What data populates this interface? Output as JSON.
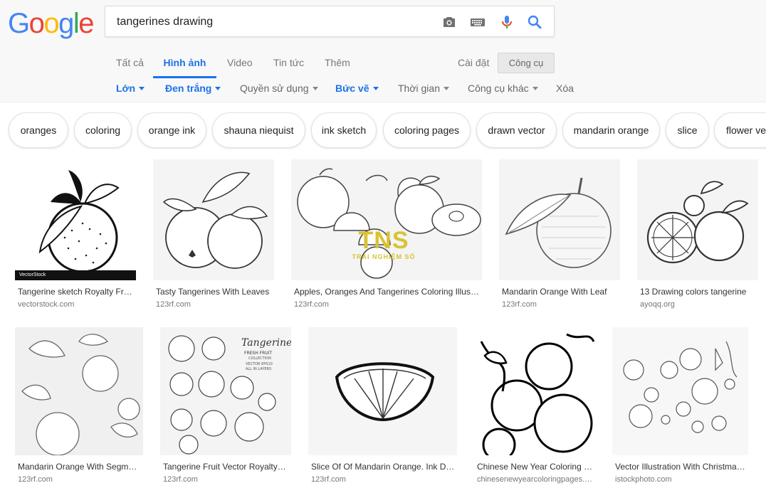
{
  "logo": {
    "letters": [
      "G",
      "o",
      "o",
      "g",
      "l",
      "e"
    ],
    "colors": [
      "#4285f4",
      "#ea4335",
      "#fbbc05",
      "#4285f4",
      "#34a853",
      "#ea4335"
    ]
  },
  "search": {
    "query": "tangerines drawing"
  },
  "icons": {
    "camera": "camera-icon",
    "keyboard": "keyboard-icon",
    "mic": "mic-icon",
    "search": "search-icon"
  },
  "tabs": [
    {
      "label": "Tất cả"
    },
    {
      "label": "Hình ảnh",
      "active": true
    },
    {
      "label": "Video"
    },
    {
      "label": "Tin tức"
    },
    {
      "label": "Thêm"
    }
  ],
  "settings_label": "Cài đặt",
  "tools_label": "Công cụ",
  "filters": [
    {
      "label": "Lớn",
      "selected": true,
      "dropdown": true
    },
    {
      "label": "Đen trắng",
      "selected": true,
      "dropdown": true
    },
    {
      "label": "Quyền sử dụng",
      "selected": false,
      "dropdown": true
    },
    {
      "label": "Bức vẽ",
      "selected": true,
      "dropdown": true
    },
    {
      "label": "Thời gian",
      "selected": false,
      "dropdown": true
    },
    {
      "label": "Công cụ khác",
      "selected": false,
      "dropdown": true
    },
    {
      "label": "Xóa",
      "selected": false,
      "dropdown": false
    }
  ],
  "chips": [
    "oranges",
    "coloring",
    "orange ink",
    "shauna niequist",
    "ink sketch",
    "coloring pages",
    "drawn vector",
    "mandarin orange",
    "slice",
    "flower vector"
  ],
  "results": [
    {
      "caption": "Tangerine sketch Royalty Free Vector Image",
      "source": "vectorstock.com",
      "watermark": "VectorStock"
    },
    {
      "caption": "Tasty Tangerines With Leaves",
      "source": "123rf.com"
    },
    {
      "caption": "Apples, Oranges And Tangerines Coloring Illustration",
      "source": "123rf.com",
      "logo_text": "TNS",
      "logo_sub": "TRẢI NGHIỆM SỐ"
    },
    {
      "caption": "Mandarin Orange With Leaf",
      "source": "123rf.com"
    },
    {
      "caption": "13 Drawing colors tangerine",
      "source": "ayoqq.org"
    },
    {
      "caption": "Mandarin Orange With Segments",
      "source": "123rf.com"
    },
    {
      "caption": "Tangerine Fruit Vector Royalty Free",
      "source": "123rf.com",
      "art_title": "Tangerine",
      "art_sub1": "FRESH FRUIT",
      "art_sub2": "COLLECTION",
      "art_sub3": "VECTOR EPS10",
      "art_sub4": "ALL IN LAYERS"
    },
    {
      "caption": "Slice Of Of Mandarin Orange. Ink Drawing",
      "source": "123rf.com"
    },
    {
      "caption": "Chinese New Year Coloring Pages",
      "source": "chinesenewyearcoloringpages.com"
    },
    {
      "caption": "Vector Illustration With Christmas Decorations",
      "source": "istockphoto.com"
    }
  ]
}
